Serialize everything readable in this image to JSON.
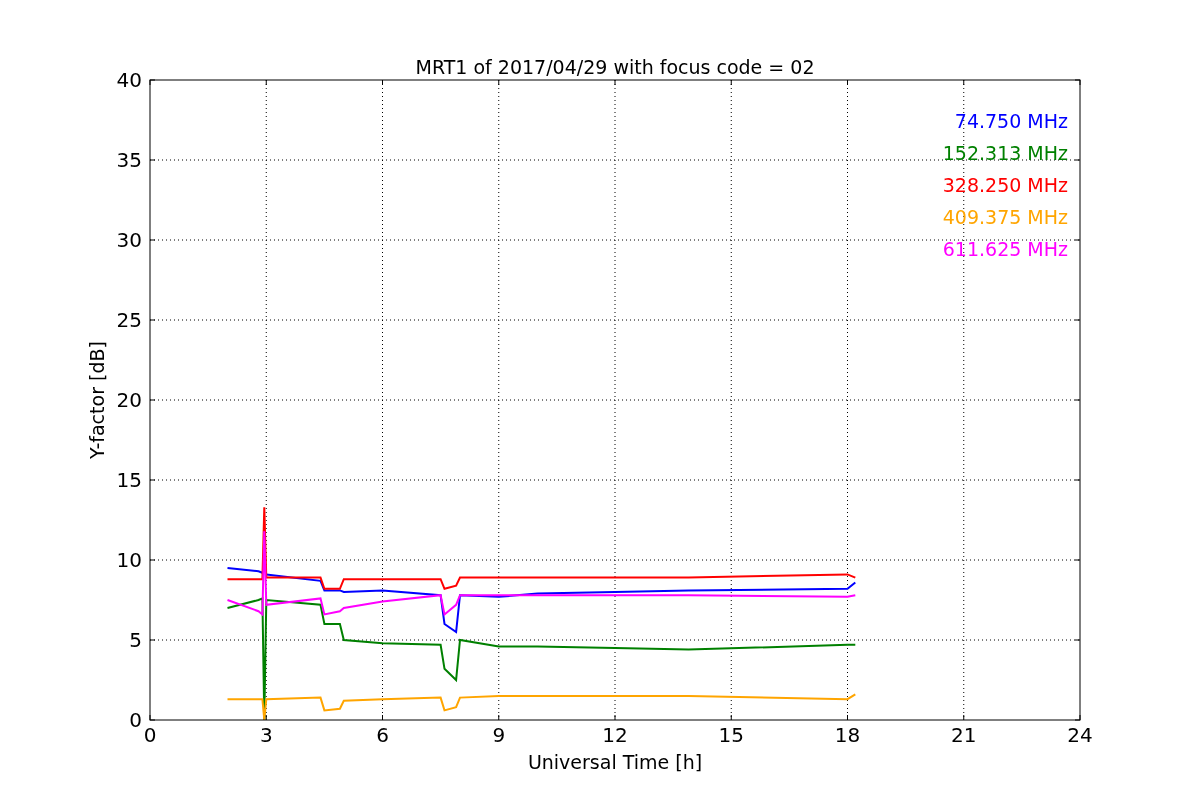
{
  "figure": {
    "chart_data": {
      "type": "line",
      "title": "MRT1 of 2017/04/29 with focus code = 02",
      "xlabel": "Universal Time [h]",
      "ylabel": "Y-factor [dB]",
      "x": [
        2,
        2.8,
        2.9,
        2.95,
        3,
        4.4,
        4.5,
        4.9,
        5,
        6,
        7.5,
        7.6,
        7.9,
        8,
        9,
        10,
        12,
        13.9,
        18,
        18.2
      ],
      "series": [
        {
          "name": "74.750 MHz",
          "color": "#0000ff",
          "values": [
            9.5,
            9.3,
            9.2,
            null,
            9.1,
            8.7,
            8.1,
            8.1,
            8.0,
            8.1,
            7.8,
            6.0,
            5.5,
            7.8,
            7.7,
            7.9,
            8.0,
            8.1,
            8.2,
            8.6
          ]
        },
        {
          "name": "152.313 MHz",
          "color": "#008000",
          "values": [
            7.0,
            7.5,
            7.6,
            0,
            7.5,
            7.2,
            6.0,
            6.0,
            5.0,
            4.8,
            4.7,
            3.2,
            2.5,
            5.0,
            4.6,
            4.6,
            4.5,
            4.4,
            4.7,
            4.7
          ]
        },
        {
          "name": "328.250 MHz",
          "color": "#ff0000",
          "values": [
            8.8,
            8.8,
            8.8,
            13.3,
            8.9,
            8.9,
            8.2,
            8.2,
            8.8,
            8.8,
            8.8,
            8.2,
            8.4,
            8.9,
            8.9,
            8.9,
            8.9,
            8.9,
            9.1,
            8.9
          ]
        },
        {
          "name": "409.375 MHz",
          "color": "#ffa500",
          "values": [
            1.3,
            1.3,
            1.3,
            0,
            1.3,
            1.4,
            0.6,
            0.7,
            1.2,
            1.3,
            1.4,
            0.6,
            0.8,
            1.4,
            1.5,
            1.5,
            1.5,
            1.5,
            1.3,
            1.6
          ]
        },
        {
          "name": "611.625 MHz",
          "color": "#ff00ff",
          "values": [
            7.5,
            6.8,
            6.6,
            11.8,
            7.2,
            7.6,
            6.6,
            6.8,
            7.0,
            7.4,
            7.8,
            6.6,
            7.2,
            7.8,
            7.8,
            7.8,
            7.8,
            7.8,
            7.7,
            7.8
          ]
        }
      ],
      "grid": true,
      "xlim": [
        0,
        24
      ],
      "ylim": [
        0,
        40
      ],
      "xticks": [
        0,
        3,
        6,
        9,
        12,
        15,
        18,
        21,
        24
      ],
      "yticks": [
        0,
        5,
        10,
        15,
        20,
        25,
        30,
        35,
        40
      ]
    }
  }
}
